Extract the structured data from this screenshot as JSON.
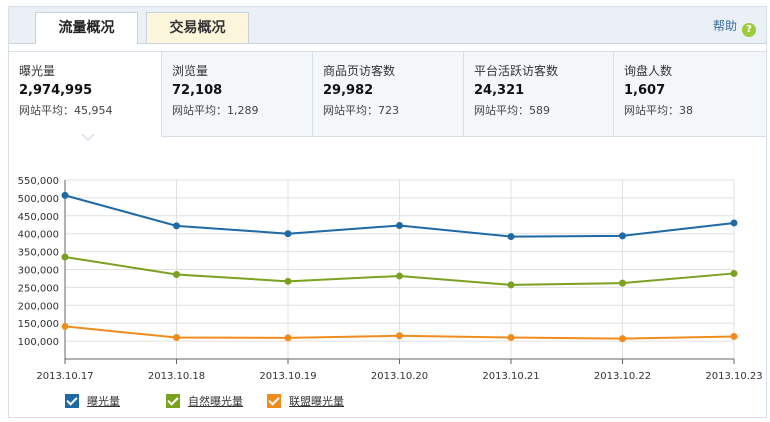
{
  "tabs": [
    {
      "label": "流量概况",
      "active": true
    },
    {
      "label": "交易概况",
      "active": false
    }
  ],
  "help": {
    "label": "帮助",
    "icon": "question-icon"
  },
  "stats": [
    {
      "name": "曝光量",
      "value": "2,974,995",
      "avg": "网站平均：45,954",
      "active": true
    },
    {
      "name": "浏览量",
      "value": "72,108",
      "avg": "网站平均：1,289",
      "active": false
    },
    {
      "name": "商品页访客数",
      "value": "29,982",
      "avg": "网站平均：723",
      "active": false
    },
    {
      "name": "平台活跃访客数",
      "value": "24,321",
      "avg": "网站平均：589",
      "active": false
    },
    {
      "name": "询盘人数",
      "value": "1,607",
      "avg": "网站平均：38",
      "active": false
    }
  ],
  "colors": {
    "series1": "#1f6aa5",
    "series2": "#7ba121",
    "series3": "#f08c1e",
    "grid": "#e0e0e0"
  },
  "chart_data": {
    "type": "line",
    "title": "",
    "xlabel": "",
    "ylabel": "",
    "x": [
      "2013.10.17",
      "2013.10.18",
      "2013.10.19",
      "2013.10.20",
      "2013.10.21",
      "2013.10.22",
      "2013.10.23"
    ],
    "y_ticks": [
      "550,000",
      "500,000",
      "450,000",
      "400,000",
      "350,000",
      "300,000",
      "250,000",
      "200,000",
      "150,000",
      "100,000"
    ],
    "ylim": [
      50000,
      550000
    ],
    "grid": true,
    "legend_position": "bottom-left",
    "series": [
      {
        "name": "曝光量",
        "values": [
          507000,
          422000,
          400000,
          423000,
          392000,
          394000,
          430000
        ]
      },
      {
        "name": "自然曝光量",
        "values": [
          335000,
          286000,
          267000,
          282000,
          257000,
          262000,
          289000
        ]
      },
      {
        "name": "联盟曝光量",
        "values": [
          141000,
          110000,
          109000,
          115000,
          110000,
          107000,
          113000
        ]
      }
    ]
  }
}
